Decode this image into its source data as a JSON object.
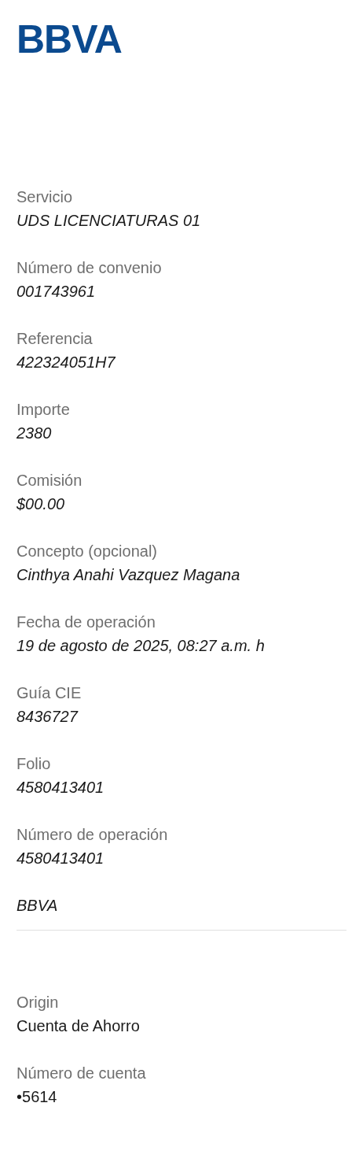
{
  "logo": "BBVA",
  "details": [
    {
      "label": "Servicio",
      "value": "UDS LICENCIATURAS 01"
    },
    {
      "label": "Número de convenio",
      "value": "001743961"
    },
    {
      "label": "Referencia",
      "value": "422324051H7"
    },
    {
      "label": "Importe",
      "value": "2380"
    },
    {
      "label": "Comisión",
      "value": "$00.00"
    },
    {
      "label": "Concepto (opcional)",
      "value": "Cinthya Anahi Vazquez Magana"
    },
    {
      "label": "Fecha de operación",
      "value": "19 de agosto de 2025, 08:27 a.m. h"
    },
    {
      "label": "Guía CIE",
      "value": "8436727"
    },
    {
      "label": "Folio",
      "value": "4580413401"
    },
    {
      "label": "Número de operación",
      "value": "4580413401"
    }
  ],
  "bank_name": "BBVA",
  "origin": [
    {
      "label": "Origin",
      "value": "Cuenta de Ahorro"
    },
    {
      "label": "Número de cuenta",
      "value": "•5614"
    }
  ]
}
